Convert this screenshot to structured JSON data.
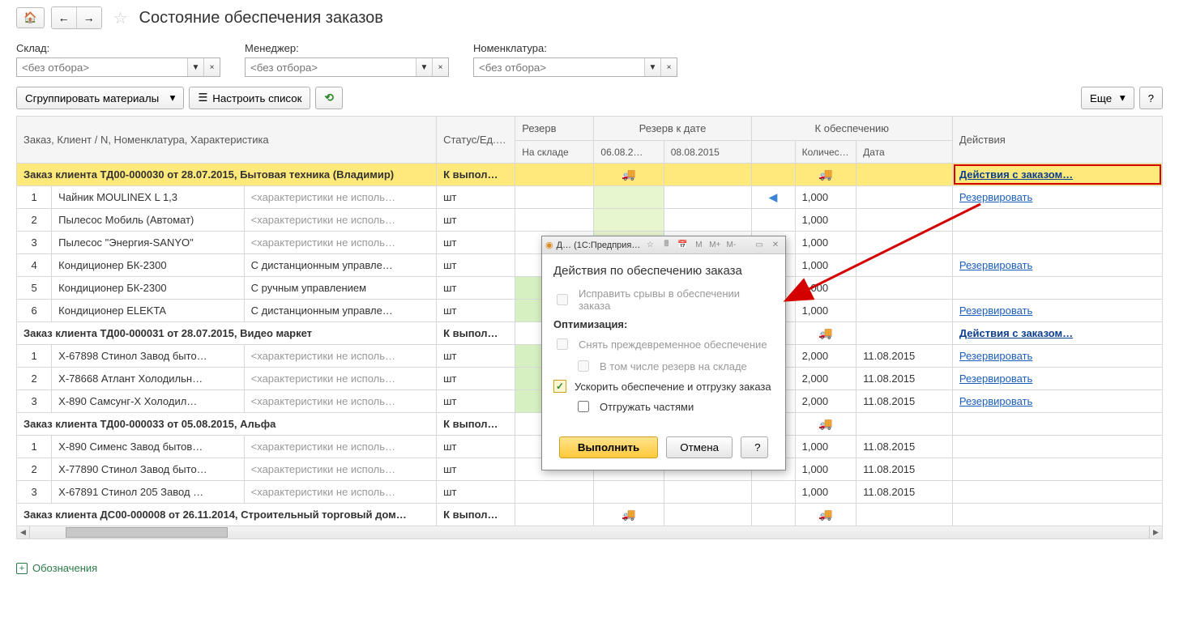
{
  "page_title": "Состояние обеспечения заказов",
  "filters": {
    "warehouse_label": "Склад:",
    "manager_label": "Менеджер:",
    "nomenclature_label": "Номенклатура:",
    "placeholder": "<без отбора>"
  },
  "toolbar": {
    "group_materials": "Сгруппировать материалы",
    "configure_list": "Настроить список",
    "more": "Еще",
    "help": "?"
  },
  "columns": {
    "order": "Заказ, Клиент / N, Номенклатура, Характеристика",
    "status": "Статус/Ед.изм.",
    "reserve": "Резерв",
    "reserve_by_date": "Резерв к дате",
    "to_provide": "К обеспечению",
    "actions": "Действия",
    "in_stock": "На складе",
    "date1": "06.08.2…",
    "date2": "08.08.2015",
    "qty": "Количест…",
    "date": "Дата"
  },
  "actions": {
    "order_actions": "Действия с заказом…",
    "reserve": "Резервировать"
  },
  "rows": [
    {
      "type": "header",
      "text": "Заказ клиента ТД00-000030 от 28.07.2015, Бытовая техника (Владимир)",
      "status": "К выпол…",
      "yellow": true,
      "truck_reserve": true,
      "truck_provide": true,
      "action": "order_actions"
    },
    {
      "n": "1",
      "nom": "Чайник MOULINEX L 1,3",
      "char": "<характеристики не исполь…",
      "unit": "шт",
      "green_reserve": true,
      "arrow": true,
      "qty": "1,000",
      "action": "reserve"
    },
    {
      "n": "2",
      "nom": "Пылесос Мобиль (Автомат)",
      "char": "<характеристики не исполь…",
      "unit": "шт",
      "green_reserve": true,
      "qty": "1,000"
    },
    {
      "n": "3",
      "nom": "Пылесос \"Энергия-SANYO\"",
      "char": "<характеристики не исполь…",
      "unit": "шт",
      "green_reserve": true,
      "qty": "1,000"
    },
    {
      "n": "4",
      "nom": "Кондиционер БК-2300",
      "char": "С дистанционным управле…",
      "unit": "шт",
      "green_reserve": true,
      "arrow": true,
      "qty": "1,000",
      "action": "reserve"
    },
    {
      "n": "5",
      "nom": "Кондиционер БК-2300",
      "char": "С ручным управлением",
      "unit": "шт",
      "green_stock": true,
      "qty": "1,000"
    },
    {
      "n": "6",
      "nom": "Кондиционер ELEKTA",
      "char": "С дистанционным управле…",
      "unit": "шт",
      "green_stock": true,
      "arrow": true,
      "qty": "1,000",
      "action": "reserve"
    },
    {
      "type": "header",
      "text": "Заказ клиента ТД00-000031 от 28.07.2015, Видео маркет",
      "status": "К выпол…",
      "truck_provide": true,
      "action": "order_actions"
    },
    {
      "n": "1",
      "nom": "Х-67898 Стинол Завод быто…",
      "char": "<характеристики не исполь…",
      "unit": "шт",
      "green_stock": true,
      "arrow": true,
      "qty": "2,000",
      "date": "11.08.2015",
      "action": "reserve"
    },
    {
      "n": "2",
      "nom": "Х-78668 Атлант Холодильн…",
      "char": "<характеристики не исполь…",
      "unit": "шт",
      "green_stock": true,
      "arrow": true,
      "qty": "2,000",
      "date": "11.08.2015",
      "action": "reserve"
    },
    {
      "n": "3",
      "nom": "Х-890 Самсунг-Х Холодил…",
      "char": "<характеристики не исполь…",
      "unit": "шт",
      "green_stock": true,
      "arrow": true,
      "qty": "2,000",
      "date": "11.08.2015",
      "action": "reserve"
    },
    {
      "type": "header",
      "text": "Заказ клиента ТД00-000033 от 05.08.2015, Альфа",
      "status": "К выпол…",
      "truck_provide": true
    },
    {
      "n": "1",
      "nom": "Х-890 Сименс Завод бытов…",
      "char": "<характеристики не исполь…",
      "unit": "шт",
      "qty": "1,000",
      "date": "11.08.2015"
    },
    {
      "n": "2",
      "nom": "Х-77890 Стинол Завод быто…",
      "char": "<характеристики не исполь…",
      "unit": "шт",
      "qty": "1,000",
      "date": "11.08.2015"
    },
    {
      "n": "3",
      "nom": "Х-67891 Стинол 205 Завод …",
      "char": "<характеристики не исполь…",
      "unit": "шт",
      "qty": "1,000",
      "date": "11.08.2015"
    },
    {
      "type": "header",
      "text": "Заказ клиента ДС00-000008 от 26.11.2014, Строительный торговый дом…",
      "status": "К выпол…",
      "truck_reserve": true,
      "truck_provide": true
    }
  ],
  "legend": "Обозначения",
  "dialog": {
    "win_title": "Д… (1С:Предприя…",
    "heading": "Действия по обеспечению заказа",
    "fix_breaks": "Исправить срывы в обеспечении заказа",
    "optimization": "Оптимизация:",
    "remove_early": "Снять преждевременное обеспечение",
    "including_stock": "В том числе резерв на складе",
    "speed_up": "Ускорить обеспечение и отгрузку заказа",
    "ship_parts": "Отгружать частями",
    "execute": "Выполнить",
    "cancel": "Отмена",
    "help": "?"
  }
}
